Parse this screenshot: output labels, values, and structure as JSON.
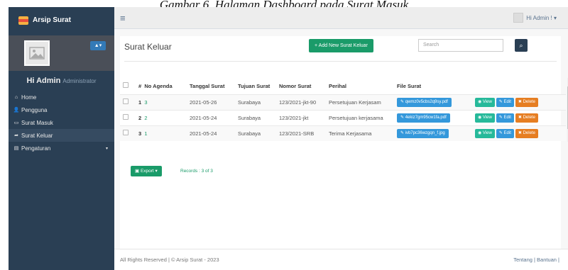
{
  "caption": "Gambar 6. Halaman Dashboard pada Surat Masuk",
  "brand": "Arsip Surat",
  "welcome": {
    "greeting": "Hi Admin",
    "role": "Administrator"
  },
  "nav": [
    {
      "label": "Home",
      "icon": "home-icon",
      "glyph": "⌂"
    },
    {
      "label": "Pengguna",
      "icon": "user-icon",
      "glyph": "👤"
    },
    {
      "label": "Surat Masuk",
      "icon": "inbox-icon",
      "glyph": "▭"
    },
    {
      "label": "Surat Keluar",
      "icon": "share-icon",
      "glyph": "➦"
    },
    {
      "label": "Pengaturan",
      "icon": "settings-icon",
      "glyph": "▤"
    }
  ],
  "topbar": {
    "user": "Hi Admin !"
  },
  "page": {
    "title": "Surat Keluar",
    "add_button": "+ Add New Surat Keluar",
    "search_placeholder": "Search",
    "export": "Export",
    "records": "Records : 3 of 3"
  },
  "table": {
    "headers": [
      "#",
      "No Agenda",
      "Tanggal Surat",
      "Tujuan Surat",
      "Nomor Surat",
      "Perihal",
      "File Surat"
    ],
    "rows": [
      {
        "num": "1",
        "agenda": "3",
        "tanggal": "2021-05-26",
        "tujuan": "Surabaya",
        "nomor": "123/2021-jkt-90",
        "perihal": "Persetujuan Kerjasam",
        "file": "qwmz0v5cbs2q9sy.pdf"
      },
      {
        "num": "2",
        "agenda": "2",
        "tanggal": "2021-05-24",
        "tujuan": "Surabaya",
        "nomor": "123/2021-jkt",
        "perihal": "Persetujuan kerjasama",
        "file": "4ekiz7gm95cw1fa.pdf"
      },
      {
        "num": "3",
        "agenda": "1",
        "tanggal": "2021-05-24",
        "tujuan": "Surabaya",
        "nomor": "123/2021-SRB",
        "perihal": "Terima Kerjasama",
        "file": "ivb7pc36wzgqn_f.jpg"
      }
    ],
    "actions": {
      "view": "View",
      "edit": "Edit",
      "delete": "Delete"
    }
  },
  "footer": {
    "left": "All Rights Reserved | © Arsip Surat - 2023",
    "right": "Tentang | Bantuan |"
  },
  "colors": {
    "sidebar": "#2a3f54",
    "accent": "#1a9b69",
    "file": "#3498db",
    "delete": "#e67e22"
  }
}
